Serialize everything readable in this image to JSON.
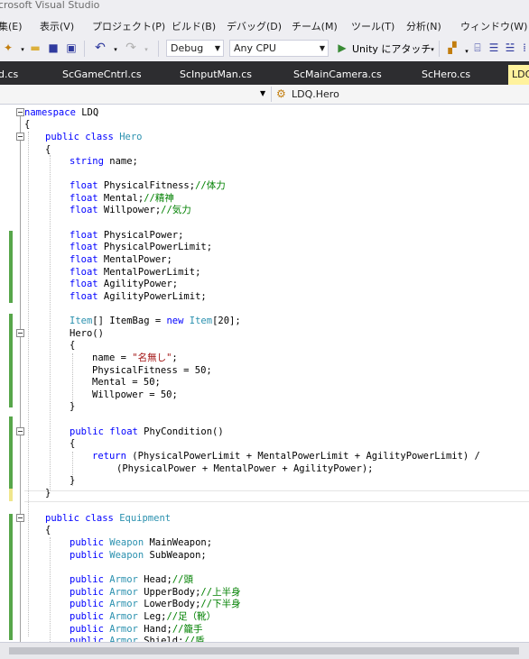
{
  "window": {
    "title": "crosoft Visual Studio"
  },
  "menu": [
    "集(E)",
    "表示(V)",
    "プロジェクト(P)",
    "ビルド(B)",
    "デバッグ(D)",
    "チーム(M)",
    "ツール(T)",
    "分析(N)",
    "ウィンドウ(W)"
  ],
  "toolbar": {
    "config": "Debug",
    "platform": "Any CPU",
    "attach_label": "Unity にアタッチ",
    "icons": [
      "new-item-icon",
      "open-folder-icon",
      "save-icon",
      "save-all-icon",
      "undo-icon",
      "redo-icon",
      "play-icon",
      "find-icon",
      "bookmark-icon",
      "comment-icon"
    ]
  },
  "tabs": [
    "d.cs",
    "ScGameCntrl.cs",
    "ScInputMan.cs",
    "ScMainCamera.cs",
    "ScHero.cs",
    "LDQ"
  ],
  "active_tab_index": 5,
  "navbar": {
    "member": "LDQ.Hero"
  },
  "colors": {
    "keyword": "#0000ff",
    "type": "#2b91af",
    "comment": "#008000",
    "string": "#a31515",
    "tab_bar": "#2d2d30",
    "active_tab": "#fff29d",
    "change_green": "#57a64a"
  },
  "code": [
    "namespace LDQ",
    "{",
    "public class Hero",
    "{",
    "string name;",
    "",
    "float PhysicalFitness;//体力",
    "float Mental;//精神",
    "float Willpower;//気力",
    "",
    "float PhysicalPower;",
    "float PhysicalPowerLimit;",
    "float MentalPower;",
    "float MentalPowerLimit;",
    "float AgilityPower;",
    "float AgilityPowerLimit;",
    "",
    "Item[] ItemBag = new Item[20];",
    "Hero()",
    "{",
    "name = \"名無し\";",
    "PhysicalFitness = 50;",
    "Mental = 50;",
    "Willpower = 50;",
    "}",
    "",
    "public float PhyCondition()",
    "{",
    "return (PhysicalPowerLimit + MentalPowerLimit + AgilityPowerLimit) /",
    "(PhysicalPower + MentalPower + AgilityPower);",
    "}",
    "}",
    "",
    "public class Equipment",
    "{",
    "public Weapon MainWeapon;",
    "public Weapon SubWeapon;",
    "",
    "public Armor Head;//頭",
    "public Armor UpperBody;//上半身",
    "public Armor LowerBody;//下半身",
    "public Armor Leg;//足（靴）",
    "public Armor Hand;//籠手",
    "public Armor Shield;//盾"
  ]
}
